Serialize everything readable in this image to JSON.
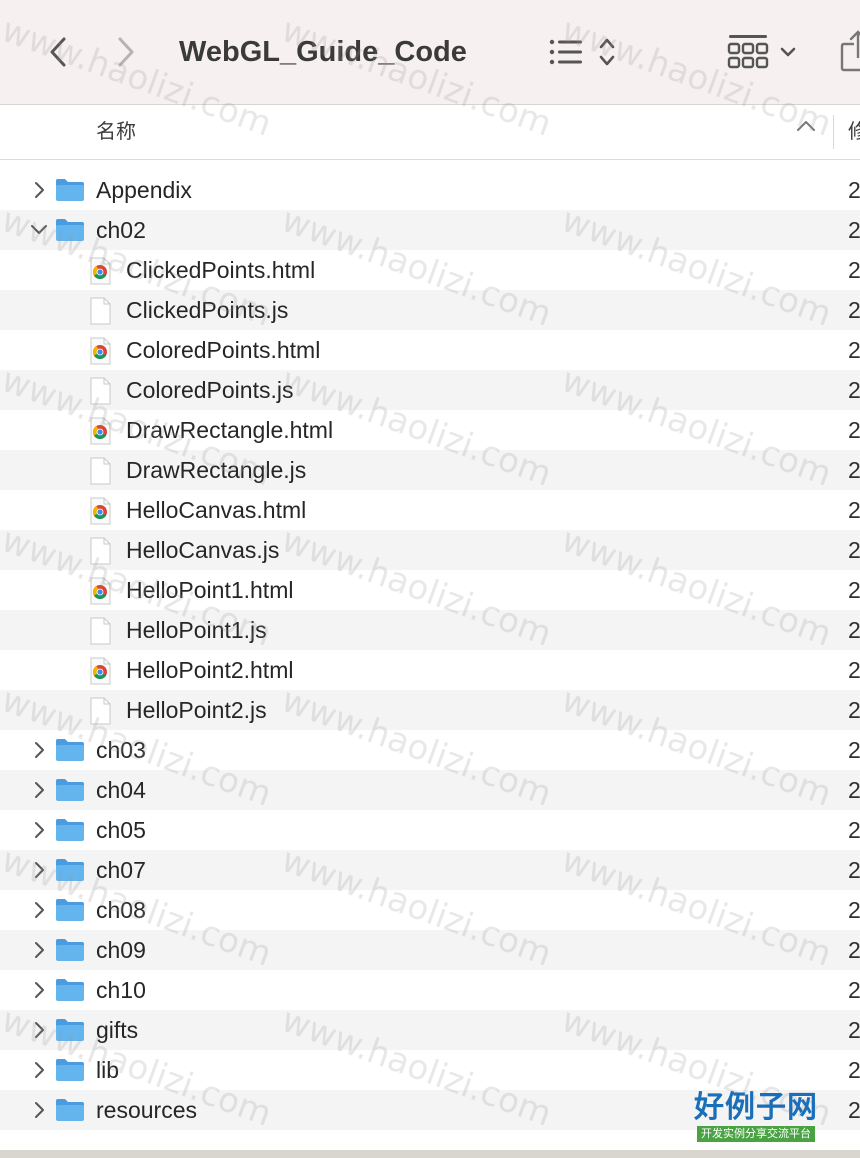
{
  "window": {
    "title": "WebGL_Guide_Code"
  },
  "header": {
    "name_column": "名称",
    "modified_column": "修"
  },
  "rows": [
    {
      "name": "Appendix",
      "kind": "folder",
      "level": 0,
      "expanded": false,
      "date": "2"
    },
    {
      "name": "ch02",
      "kind": "folder",
      "level": 0,
      "expanded": true,
      "date": "2"
    },
    {
      "name": "ClickedPoints.html",
      "kind": "html",
      "level": 1,
      "date": "2"
    },
    {
      "name": "ClickedPoints.js",
      "kind": "js",
      "level": 1,
      "date": "2"
    },
    {
      "name": "ColoredPoints.html",
      "kind": "html",
      "level": 1,
      "date": "2"
    },
    {
      "name": "ColoredPoints.js",
      "kind": "js",
      "level": 1,
      "date": "2"
    },
    {
      "name": "DrawRectangle.html",
      "kind": "html",
      "level": 1,
      "date": "2"
    },
    {
      "name": "DrawRectangle.js",
      "kind": "js",
      "level": 1,
      "date": "2"
    },
    {
      "name": "HelloCanvas.html",
      "kind": "html",
      "level": 1,
      "date": "2"
    },
    {
      "name": "HelloCanvas.js",
      "kind": "js",
      "level": 1,
      "date": "2"
    },
    {
      "name": "HelloPoint1.html",
      "kind": "html",
      "level": 1,
      "date": "2"
    },
    {
      "name": "HelloPoint1.js",
      "kind": "js",
      "level": 1,
      "date": "2"
    },
    {
      "name": "HelloPoint2.html",
      "kind": "html",
      "level": 1,
      "date": "2"
    },
    {
      "name": "HelloPoint2.js",
      "kind": "js",
      "level": 1,
      "date": "2"
    },
    {
      "name": "ch03",
      "kind": "folder",
      "level": 0,
      "expanded": false,
      "date": "2"
    },
    {
      "name": "ch04",
      "kind": "folder",
      "level": 0,
      "expanded": false,
      "date": "2"
    },
    {
      "name": "ch05",
      "kind": "folder",
      "level": 0,
      "expanded": false,
      "date": "2"
    },
    {
      "name": "ch07",
      "kind": "folder",
      "level": 0,
      "expanded": false,
      "date": "2"
    },
    {
      "name": "ch08",
      "kind": "folder",
      "level": 0,
      "expanded": false,
      "date": "2"
    },
    {
      "name": "ch09",
      "kind": "folder",
      "level": 0,
      "expanded": false,
      "date": "2"
    },
    {
      "name": "ch10",
      "kind": "folder",
      "level": 0,
      "expanded": false,
      "date": "2"
    },
    {
      "name": "gifts",
      "kind": "folder",
      "level": 0,
      "expanded": false,
      "date": "2"
    },
    {
      "name": "lib",
      "kind": "folder",
      "level": 0,
      "expanded": false,
      "date": "2"
    },
    {
      "name": "resources",
      "kind": "folder",
      "level": 0,
      "expanded": false,
      "date": "2"
    }
  ],
  "icons": {
    "back": "chevron-left-icon",
    "forward": "chevron-right-icon",
    "sort": "list-sort-icon",
    "view": "grid-view-icon",
    "share": "share-icon",
    "folder": "folder-icon",
    "html": "chrome-file-icon",
    "js": "blank-file-icon"
  },
  "colors": {
    "toolbar": "#f7f0f0",
    "folder": "#5aaee8",
    "alt_row": "#f4f4f5"
  },
  "watermark": {
    "text": "www.haolizi.com",
    "brand_title": "好例子网",
    "brand_sub": "开发实例分享交流平台"
  }
}
